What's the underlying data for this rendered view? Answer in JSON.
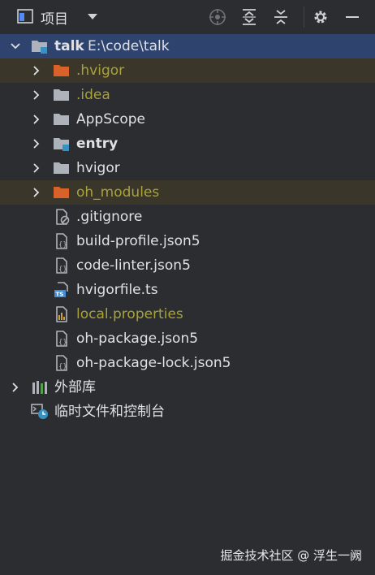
{
  "toolbar": {
    "title": "项目",
    "icons": [
      "project-view-icon",
      "dropdown-icon",
      "locate-icon",
      "expand-all-icon",
      "collapse-all-icon",
      "settings-icon",
      "hide-icon"
    ]
  },
  "tree": {
    "root": {
      "name": "talk",
      "path": "E:\\code\\talk"
    },
    "children": [
      {
        "label": ".hvigor",
        "kind": "folder-excluded"
      },
      {
        "label": ".idea",
        "kind": "folder"
      },
      {
        "label": "AppScope",
        "kind": "folder"
      },
      {
        "label": "entry",
        "kind": "module"
      },
      {
        "label": "hvigor",
        "kind": "folder"
      },
      {
        "label": "oh_modules",
        "kind": "folder-excluded"
      },
      {
        "label": ".gitignore",
        "kind": "file-ignore"
      },
      {
        "label": "build-profile.json5",
        "kind": "file-json"
      },
      {
        "label": "code-linter.json5",
        "kind": "file-json"
      },
      {
        "label": "hvigorfile.ts",
        "kind": "file-ts"
      },
      {
        "label": "local.properties",
        "kind": "file-properties"
      },
      {
        "label": "oh-package.json5",
        "kind": "file-json"
      },
      {
        "label": "oh-package-lock.json5",
        "kind": "file-json"
      }
    ],
    "external_libraries": "外部库",
    "scratches": "临时文件和控制台"
  },
  "watermark": "掘金技术社区 @ 浮生一阙",
  "colors": {
    "background": "#2b2d30",
    "selected": "#2e436e",
    "excluded_bg": "#3a362a",
    "excluded_text": "#a9a23a",
    "excluded_folder": "#d9622b"
  }
}
